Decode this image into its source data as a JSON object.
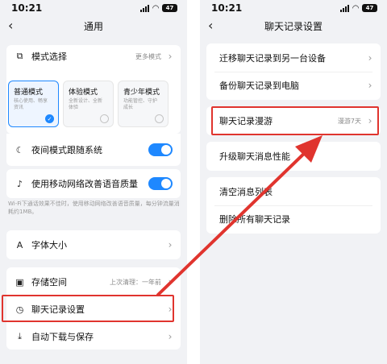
{
  "left": {
    "status": {
      "time": "10:21",
      "battery": "47"
    },
    "title": "通用",
    "mode": {
      "label": "模式选择",
      "more": "更多模式",
      "options": [
        {
          "title": "普通模式",
          "desc": "核心使用、畅享资讯",
          "selected": true
        },
        {
          "title": "体验模式",
          "desc": "全新设计、全新体验"
        },
        {
          "title": "青少年模式",
          "desc": "功能管控、守护成长"
        }
      ]
    },
    "night": {
      "label": "夜间模式跟随系统",
      "on": true
    },
    "mobile_audio": {
      "label": "使用移动网络改善语音质量",
      "on": true
    },
    "note": "Wi-Fi下通话效果不佳时，使用移动网络改善语音质量，每分钟流量消耗约1MB。",
    "font_size": {
      "label": "字体大小"
    },
    "storage": {
      "label": "存储空间",
      "value": "上次清理：一年前"
    },
    "chat_settings": {
      "label": "聊天记录设置"
    },
    "auto_download": {
      "label": "自动下载与保存"
    }
  },
  "right": {
    "status": {
      "time": "10:21",
      "battery": "47"
    },
    "title": "聊天记录设置",
    "items": {
      "migrate": "迁移聊天记录到另一台设备",
      "backup": "备份聊天记录到电脑",
      "roaming": "聊天记录漫游",
      "roaming_value": "漫游7天",
      "upgrade": "升级聊天消息性能",
      "clear_list": "清空消息列表",
      "delete_all": "删除所有聊天记录"
    }
  },
  "colors": {
    "accent": "#1e88ff",
    "highlight": "#e0342e"
  }
}
